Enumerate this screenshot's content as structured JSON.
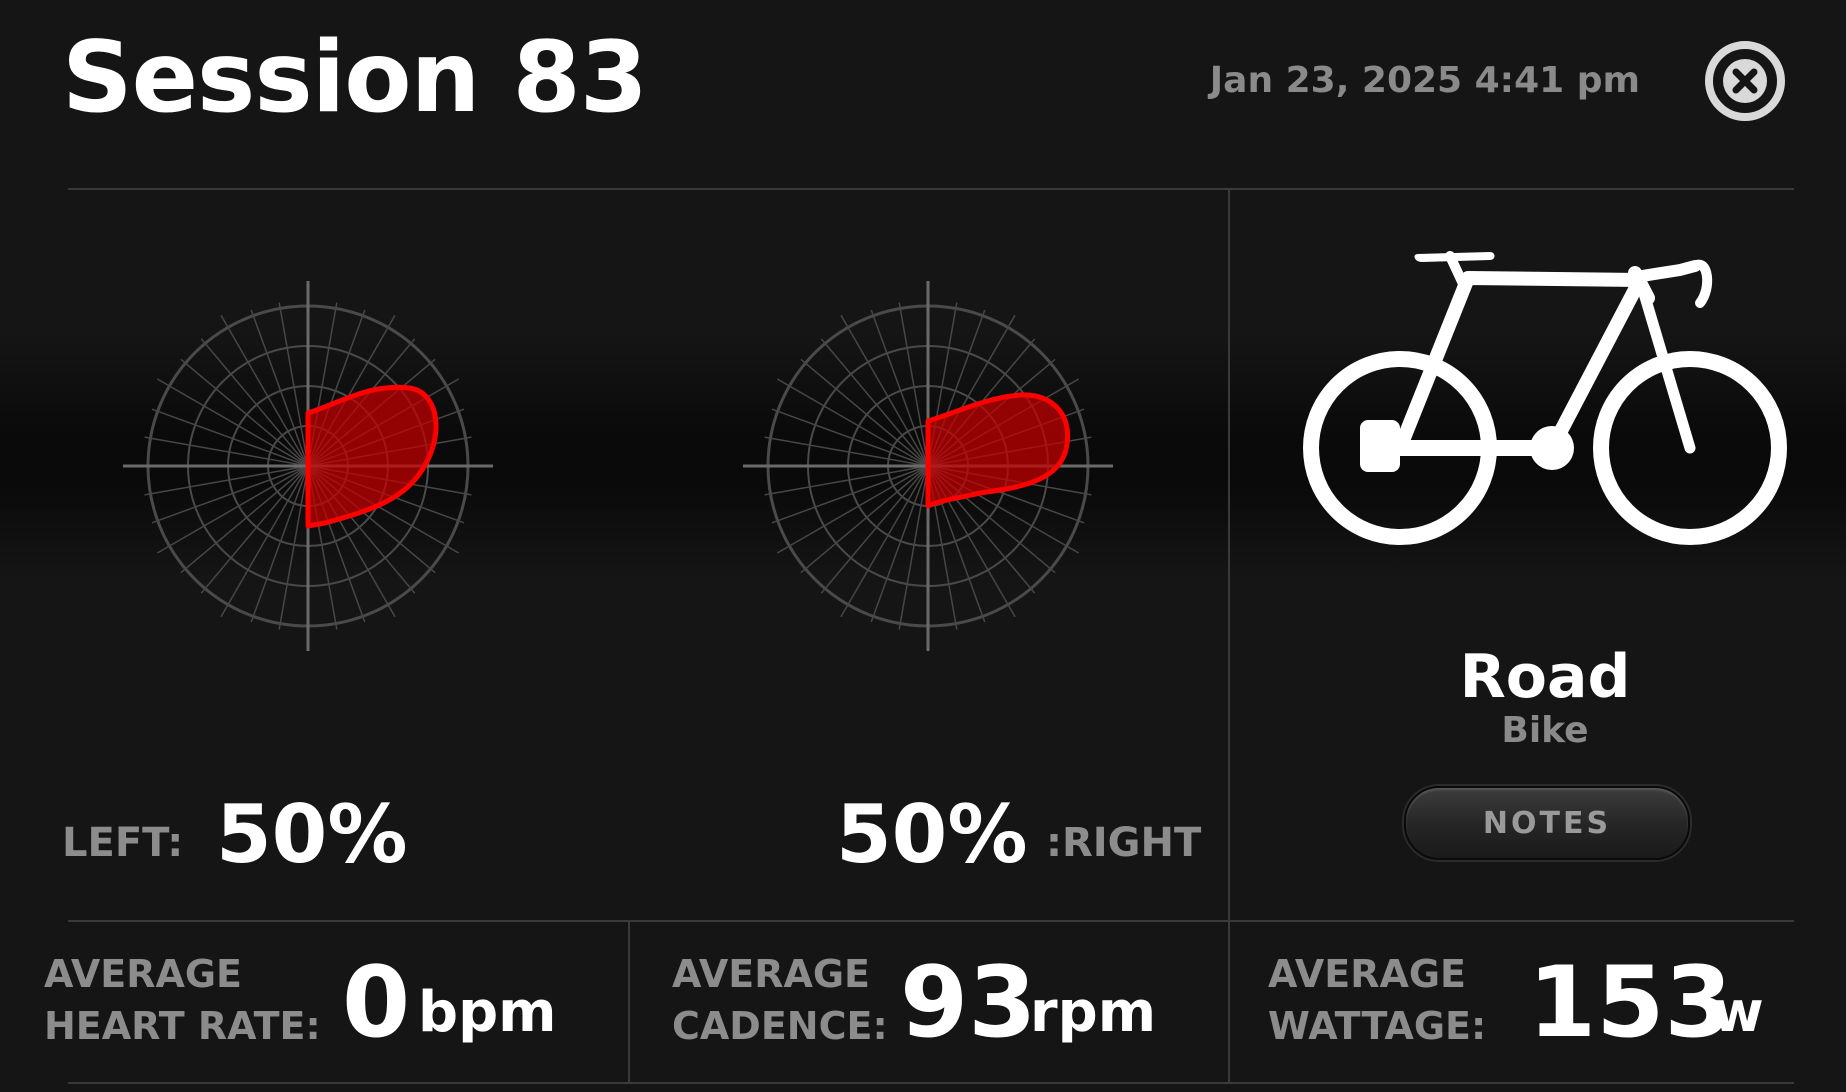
{
  "header": {
    "title": "Session 83",
    "datetime": "Jan 23, 2025 4:41 pm",
    "close_icon": "close-circle-icon"
  },
  "pedal": {
    "left_label": "LEFT:",
    "left_percent": "50%",
    "right_label": ":RIGHT",
    "right_percent": "50%",
    "accent_color": "#ff0000"
  },
  "bike": {
    "icon": "road-bike-icon",
    "type": "Road",
    "subtitle": "Bike",
    "notes_label": "NOTES"
  },
  "stats": {
    "heart_rate": {
      "label_line1": "AVERAGE",
      "label_line2": "HEART RATE:",
      "value": "0",
      "unit": "bpm"
    },
    "cadence": {
      "label_line1": "AVERAGE",
      "label_line2": "CADENCE:",
      "value": "93",
      "unit": "rpm"
    },
    "wattage": {
      "label_line1": "AVERAGE",
      "label_line2": "WATTAGE:",
      "value": "153",
      "unit": "w"
    }
  }
}
